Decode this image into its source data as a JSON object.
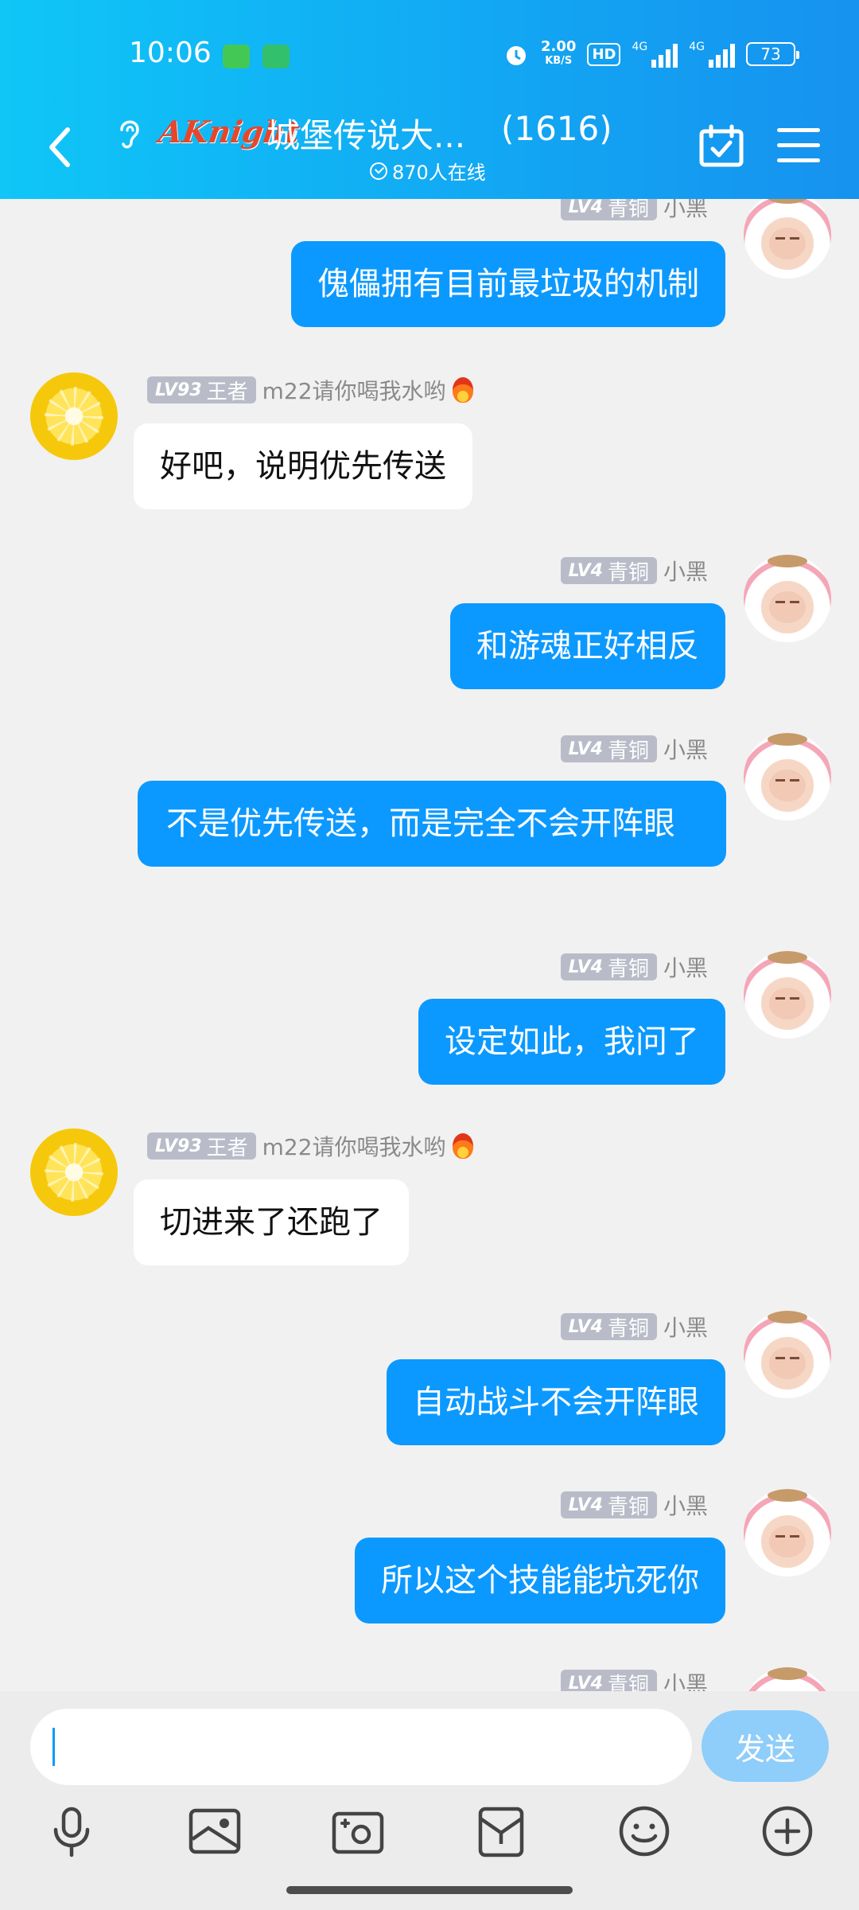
{
  "status_bar": {
    "time": "10:06",
    "net_speed": "2.00",
    "net_unit": "KB/S",
    "hd": "HD",
    "sig1": "4G",
    "sig2": "4G",
    "battery": "73"
  },
  "header": {
    "logo_text": "AKnight",
    "title": "城堡传说大...",
    "member_count": "(1616)",
    "online": "870人在线"
  },
  "messages": [
    {
      "side": "out",
      "level": "LV4",
      "rank": "青铜",
      "user": "小黑",
      "text": "傀儡拥有目前最垃圾的机制"
    },
    {
      "side": "in",
      "level": "LV93",
      "rank": "王者",
      "user": "m22请你喝我水哟",
      "text": "好吧，说明优先传送"
    },
    {
      "side": "out",
      "level": "LV4",
      "rank": "青铜",
      "user": "小黑",
      "text": "和游魂正好相反"
    },
    {
      "side": "out",
      "level": "LV4",
      "rank": "青铜",
      "user": "小黑",
      "text": "不是优先传送，而是完全不会开阵眼"
    },
    {
      "side": "out",
      "level": "LV4",
      "rank": "青铜",
      "user": "小黑",
      "text": "设定如此，我问了"
    },
    {
      "side": "in",
      "level": "LV93",
      "rank": "王者",
      "user": "m22请你喝我水哟",
      "text": "切进来了还跑了"
    },
    {
      "side": "out",
      "level": "LV4",
      "rank": "青铜",
      "user": "小黑",
      "text": "自动战斗不会开阵眼"
    },
    {
      "side": "out",
      "level": "LV4",
      "rank": "青铜",
      "user": "小黑",
      "text": "所以这个技能能坑死你"
    },
    {
      "side": "out",
      "level": "LV4",
      "rank": "青铜",
      "user": "小黑",
      "text": ""
    }
  ],
  "input": {
    "send_label": "发送"
  },
  "colors": {
    "header_gradient_start": "#0fc6f7",
    "header_gradient_end": "#1692ef",
    "outgoing_bubble": "#0b99ff",
    "incoming_bubble": "#ffffff",
    "send_button": "#8fcdfa"
  },
  "icons": {
    "toolbar": [
      "microphone-icon",
      "image-icon",
      "camera-icon",
      "wallet-icon",
      "emoji-icon",
      "plus-icon"
    ]
  }
}
